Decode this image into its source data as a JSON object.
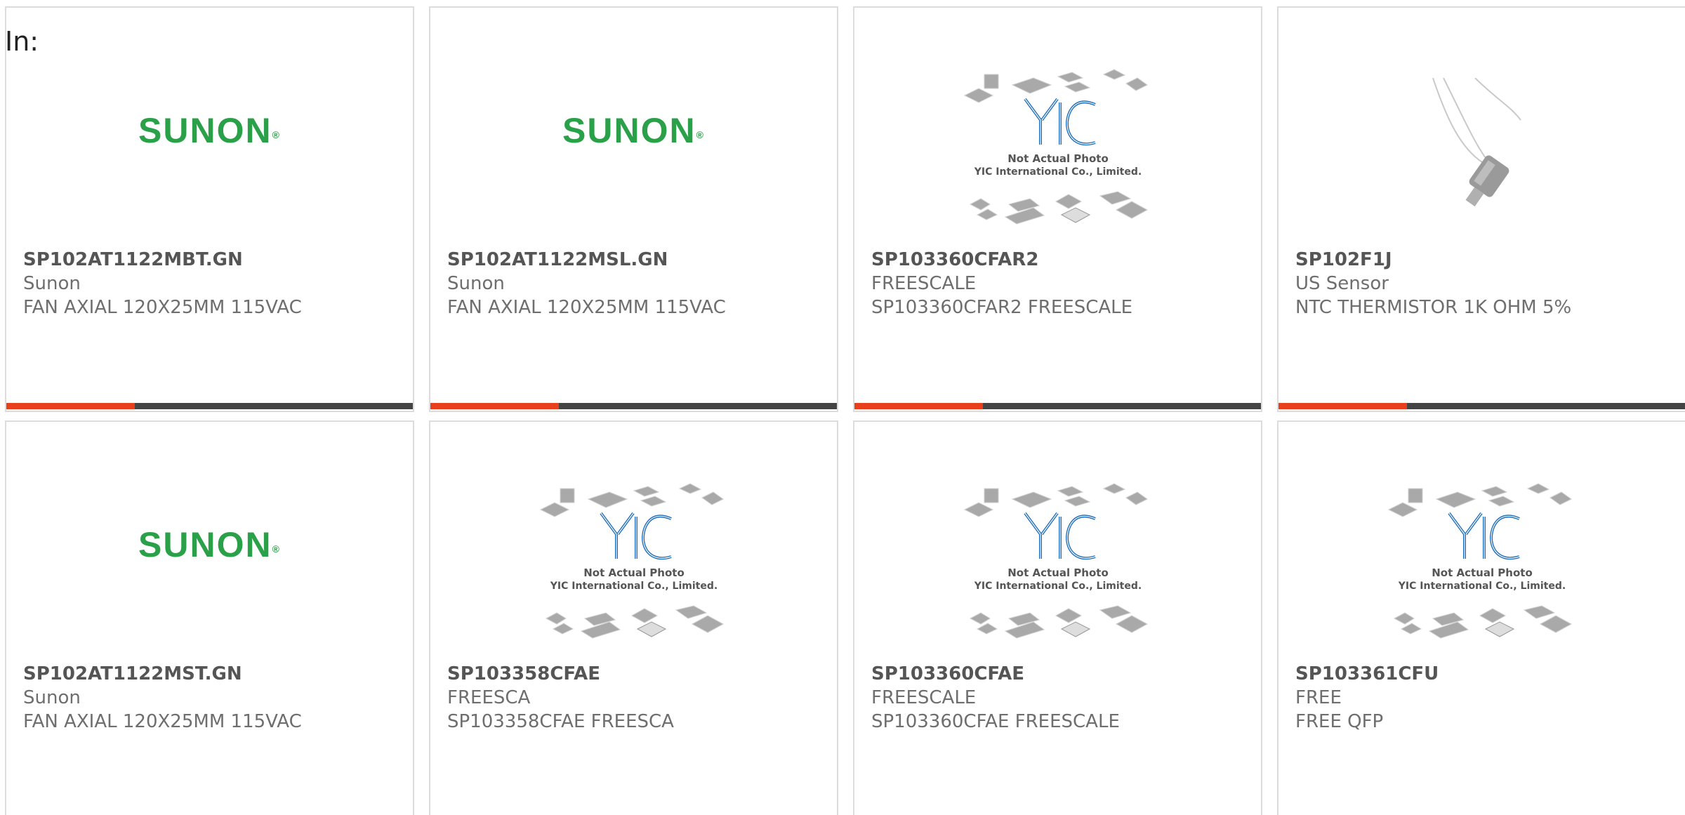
{
  "header": {
    "in_label": "In:"
  },
  "colors": {
    "accent": "#e8401c",
    "bar": "#444444",
    "sunon_green": "#2aa148",
    "yic_blue": "#1f6fbd"
  },
  "placeholder": {
    "line1": "Not Actual Photo",
    "line2": "YIC International Co., Limited.",
    "logo": "YIC"
  },
  "sunon_logo": {
    "text": "SUNON",
    "mark": "®"
  },
  "products": [
    {
      "part": "SP102AT1122MBT.GN",
      "maker": "Sunon",
      "desc": "FAN AXIAL 120X25MM 115VAC",
      "image": "sunon-logo"
    },
    {
      "part": "SP102AT1122MSL.GN",
      "maker": "Sunon",
      "desc": "FAN AXIAL 120X25MM 115VAC",
      "image": "sunon-logo"
    },
    {
      "part": "SP103360CFAR2",
      "maker": "FREESCALE",
      "desc": "SP103360CFAR2 FREESCALE",
      "image": "yic-placeholder"
    },
    {
      "part": "SP102F1J",
      "maker": "US Sensor",
      "desc": "NTC THERMISTOR 1K OHM 5%",
      "image": "thermistor-photo"
    },
    {
      "part": "SP102AT1122MST.GN",
      "maker": "Sunon",
      "desc": "FAN AXIAL 120X25MM 115VAC",
      "image": "sunon-logo"
    },
    {
      "part": "SP103358CFAE",
      "maker": "FREESCA",
      "desc": "SP103358CFAE FREESCA",
      "image": "yic-placeholder"
    },
    {
      "part": "SP103360CFAE",
      "maker": "FREESCALE",
      "desc": "SP103360CFAE FREESCALE",
      "image": "yic-placeholder"
    },
    {
      "part": "SP103361CFU",
      "maker": "FREE",
      "desc": "FREE QFP",
      "image": "yic-placeholder"
    }
  ]
}
